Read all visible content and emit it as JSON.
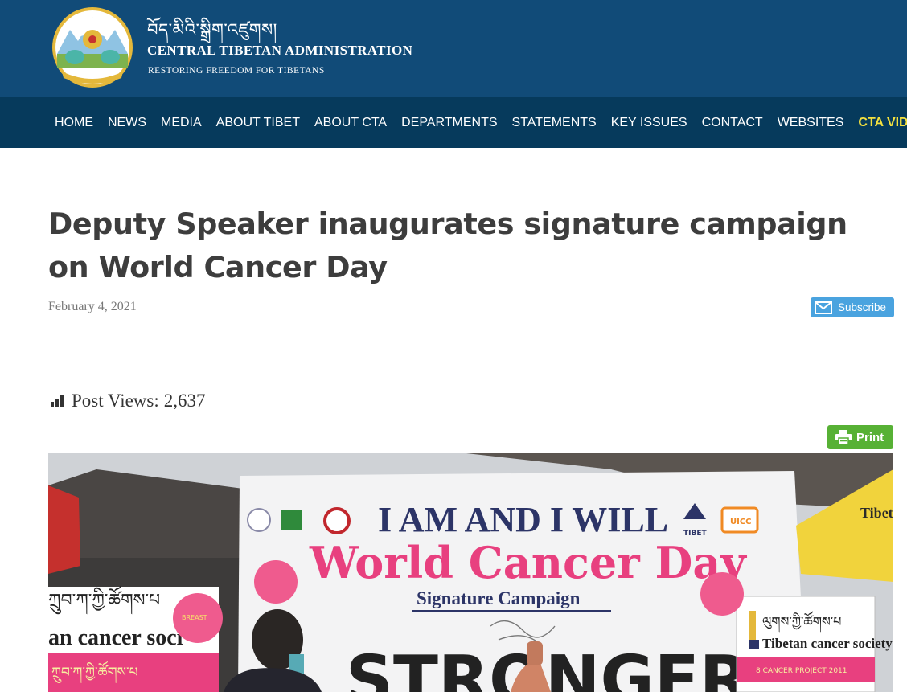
{
  "header": {
    "tibetan_name": "བོད་མིའི་སྒྲིག་འཛུགས།",
    "org_name": "CENTRAL TIBETAN ADMINISTRATION",
    "tagline": "RESTORING FREEDOM FOR TIBETANS",
    "logo": "snow-lion-emblem"
  },
  "nav": {
    "items": [
      {
        "label": "HOME"
      },
      {
        "label": "NEWS"
      },
      {
        "label": "MEDIA"
      },
      {
        "label": "ABOUT TIBET"
      },
      {
        "label": "ABOUT CTA"
      },
      {
        "label": "DEPARTMENTS"
      },
      {
        "label": "STATEMENTS"
      },
      {
        "label": "KEY ISSUES"
      },
      {
        "label": "CONTACT"
      },
      {
        "label": "WEBSITES"
      },
      {
        "label": "CTA VIDEOS"
      }
    ],
    "highlight_color": "#f3e03f"
  },
  "article": {
    "title": "Deputy Speaker inaugurates signature campaign on World Cancer Day",
    "date": "February 4, 2021",
    "subscribe_label": "Subscribe",
    "views_label": "Post Views:",
    "views_count": "2,637",
    "print_label": "Print"
  },
  "photo": {
    "banner_line1": "I AM AND I WILL",
    "banner_line2": "World Cancer Day",
    "banner_line3": "Signature Campaign",
    "banner_bottom": "STRONGER",
    "banner_logo_tibet": "TIBET",
    "banner_logo_uicc": "UICC",
    "sign_left_tibetan": "ཀྲུབ་ཀ་ཀྱི་ཚོགས་པ",
    "sign_left_english": "an cancer soci",
    "sign_left_bottom": "ཀྲུབ་ཀ་ཀྱི་ཚོགས་པ",
    "sign_right_tibetan": "ལུགས་ཀྱི་ཚོགས་པ",
    "sign_right_english": "Tibetan cancer society",
    "sign_right_bottom": "8 CANCER PROJECT 2011",
    "tent_text": "Tibetan",
    "balloon_text": "BREAST"
  },
  "colors": {
    "header_bg": "#114b78",
    "nav_bg": "#063a5c",
    "subscribe_bg": "#4aa3df",
    "print_bg": "#57b135",
    "banner_pink": "#e8407f",
    "banner_navy": "#2c3467"
  }
}
